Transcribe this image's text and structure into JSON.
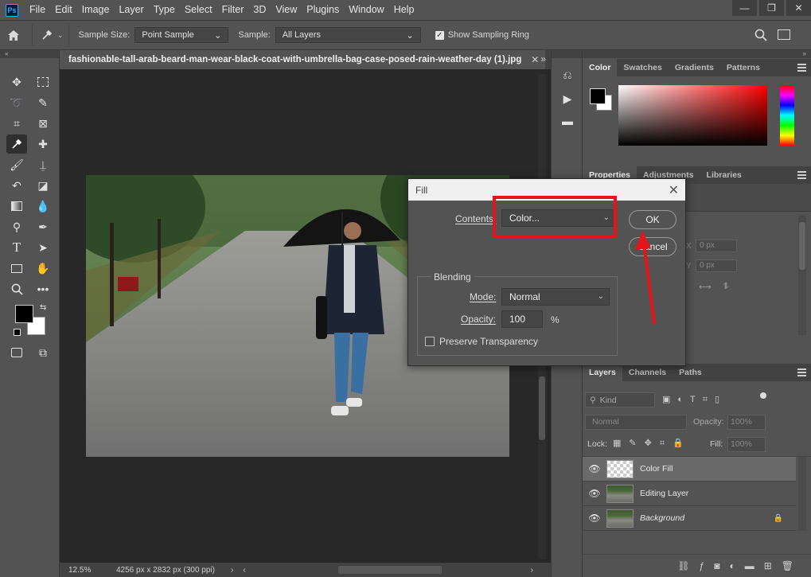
{
  "app": {
    "logo": "Ps"
  },
  "menu": [
    "File",
    "Edit",
    "Image",
    "Layer",
    "Type",
    "Select",
    "Filter",
    "3D",
    "View",
    "Plugins",
    "Window",
    "Help"
  ],
  "window_controls": {
    "minimize": "—",
    "restore": "❐",
    "close": "✕"
  },
  "options_bar": {
    "sample_size_label": "Sample Size:",
    "sample_size_value": "Point Sample",
    "sample_label": "Sample:",
    "sample_value": "All Layers",
    "sampling_ring_label": "Show Sampling Ring",
    "sampling_ring_checked": true
  },
  "document": {
    "tab_title": "fashionable-tall-arab-beard-man-wear-black-coat-with-umbrella-bag-case-posed-rain-weather-day (1).jpg",
    "zoom": "12.5%",
    "dimensions": "4256 px x 2832 px (300 ppi)"
  },
  "color_panel": {
    "tabs": [
      "Color",
      "Swatches",
      "Gradients",
      "Patterns"
    ],
    "active_tab": "Color",
    "foreground": "#000000",
    "background": "#ffffff"
  },
  "properties_panel": {
    "tabs": [
      "Properties",
      "Adjustments",
      "Libraries"
    ],
    "x_label": "X",
    "y_label": "Y",
    "x_value": "0 px",
    "y_value": "0 px"
  },
  "layers_panel": {
    "tabs": [
      "Layers",
      "Channels",
      "Paths"
    ],
    "kind_label": "Kind",
    "blend_mode": "Normal",
    "opacity_label": "Opacity:",
    "opacity_value": "100%",
    "lock_label": "Lock:",
    "fill_label": "Fill:",
    "fill_value": "100%",
    "layers": [
      {
        "name": "Color Fill",
        "selected": true,
        "thumb": "checker",
        "locked": false,
        "italic": false
      },
      {
        "name": "Editing Layer",
        "selected": false,
        "thumb": "photo",
        "locked": false,
        "italic": false
      },
      {
        "name": "Background",
        "selected": false,
        "thumb": "photo",
        "locked": true,
        "italic": true
      }
    ]
  },
  "fill_dialog": {
    "title": "Fill",
    "contents_label": "Contents:",
    "contents_value": "Color...",
    "ok_label": "OK",
    "cancel_label": "Cancel",
    "blending_label": "Blending",
    "mode_label": "Mode:",
    "mode_value": "Normal",
    "opacity_label": "Opacity:",
    "opacity_value": "100",
    "opacity_unit": "%",
    "preserve_label": "Preserve Transparency",
    "preserve_checked": false
  },
  "annotation": {
    "highlight_color": "#e3151a"
  }
}
